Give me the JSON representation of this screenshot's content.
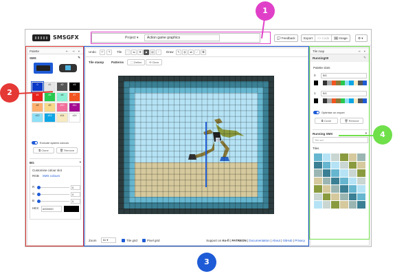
{
  "header": {
    "app_title": "SMSGFX",
    "project_label": "Project ▾",
    "project_name": "Action game graphics",
    "feedback_label": "💬 Feedback",
    "export_label": "Export",
    "code_label": "<> Code",
    "image_label": "🖼 Image",
    "settings_label": "⚙ ▾"
  },
  "palette_panel": {
    "title": "Palette",
    "controls": "⇤ ⇥ ▾",
    "system": "SMS",
    "swatches": [
      {
        "label": "0",
        "color": "#0a39c8"
      },
      {
        "label": "#1",
        "color": "#e6e6e6"
      },
      {
        "label": "#2",
        "color": "#555555"
      },
      {
        "label": "#3",
        "color": "#000000"
      },
      {
        "label": "#4",
        "color": "#e8211c"
      },
      {
        "label": "#5",
        "color": "#28c94f"
      },
      {
        "label": "#6",
        "color": "#8df0d4"
      },
      {
        "label": "#7",
        "color": "#f2551f"
      },
      {
        "label": "#8",
        "color": "#ffb06e"
      },
      {
        "label": "#9",
        "color": "#f8d889"
      },
      {
        "label": "#10",
        "color": "#f26e9b"
      },
      {
        "label": "#11",
        "color": "#a40b92"
      },
      {
        "label": "#12",
        "color": "#8ee0f7"
      },
      {
        "label": "#13",
        "color": "#0ea6e5"
      },
      {
        "label": "#14",
        "color": "#f7eac0"
      },
      {
        "label": "#15",
        "color": "#ffffff"
      }
    ],
    "exclude_label": "Exclude system colours",
    "clone_label": "⧉ Clone",
    "remove_label": "🗑 Remove",
    "section_label": "BG",
    "custom_colour": {
      "title": "Customise colour slot",
      "tab_rgb": "RGB",
      "tab_sms": "SMS colours",
      "r_label": "R",
      "g_label": "G",
      "b_label": "B",
      "r_value": "0",
      "g_value": "0",
      "b_value": "0",
      "hex_label": "HEX",
      "hex_value": "#000000"
    }
  },
  "canvas_panel": {
    "undo_label": "Undo",
    "tile_label": "Tile",
    "draw_label": "Draw",
    "tile_stamp_label": "Tile stamp",
    "patterns_label": "Patterns",
    "define_label": "⬚ Define",
    "clear_label": "⟲ Clear",
    "zoom_label": "Zoom",
    "zoom_value": "6x ▾",
    "tile_grid_label": "Tile grid",
    "pixel_grid_label": "Pixel grid",
    "support_label": "Support on",
    "kofi_label": "Ko-fi",
    "patreon_label": "PATREON",
    "footer_links": [
      "Documentation",
      "About",
      "GitHub",
      "Privacy"
    ]
  },
  "tilemap_panel": {
    "title": "Tile map",
    "controls": "⇥ ▾",
    "tilemap_name": "Running00",
    "palette_slots_label": "Palette slots",
    "slots": [
      {
        "num": "0",
        "value": "BG"
      },
      {
        "num": "1",
        "value": "BG"
      }
    ],
    "optimise_label": "Optimise on export",
    "clone_label": "⧉ Clone",
    "remove_label": "🗑 Remove",
    "tileset_label": "Running SMS",
    "tileset_placeholder": "Tile set",
    "tiles_label": "Tiles"
  },
  "annotations": {
    "marker_1": "1",
    "marker_2": "2",
    "marker_3": "3",
    "marker_4": "4"
  },
  "colors": {
    "accent": "#1e5bd6",
    "annot_pink": "#e040c8",
    "annot_red": "#e53935",
    "annot_blue": "#1e5bd6",
    "annot_green": "#6fe04a"
  }
}
